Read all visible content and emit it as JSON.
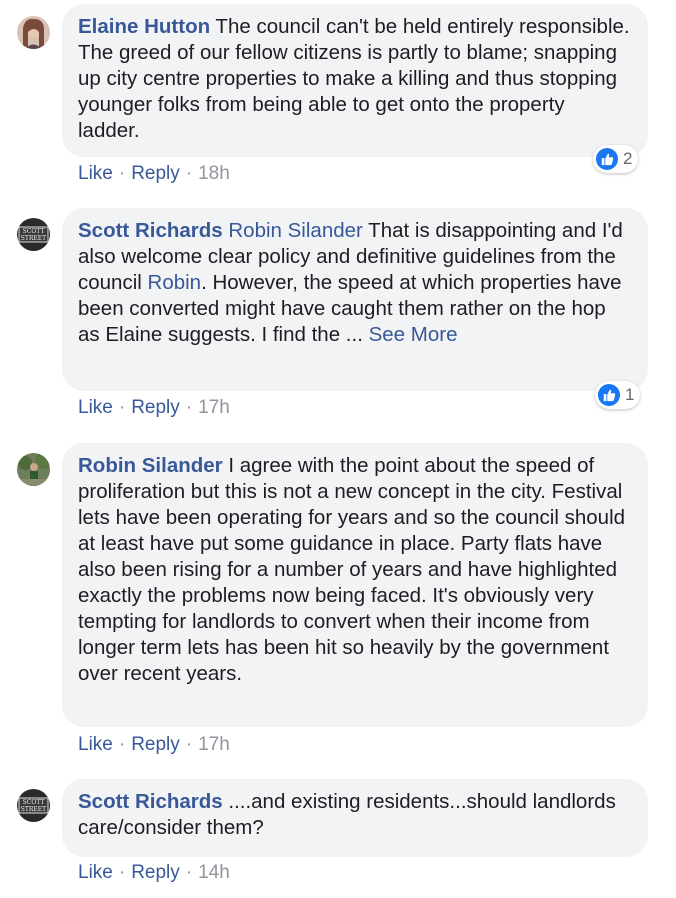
{
  "comments": [
    {
      "author": "Elaine Hutton",
      "text": " The council can't be held entirely responsible. The greed of our fellow citizens is partly to blame; snapping up city centre properties to make a killing and thus stopping younger folks from being able to get onto the property ladder.",
      "like": "Like",
      "reply": "Reply",
      "time": "18h",
      "reaction_count": "2",
      "reaction_icon": "like-icon",
      "accent": "#385898"
    },
    {
      "author": "Scott Richards",
      "mention": "Robin Silander",
      "text_a": " That is disappointing and I'd also welcome clear policy and definitive guidelines from the council ",
      "mention2": "Robin",
      "text_b": ". However, the speed at which properties have been converted might have caught them rather on the hop as Elaine suggests. I find the ... ",
      "see_more": "See More",
      "like": "Like",
      "reply": "Reply",
      "time": "17h",
      "reaction_count": "1",
      "reaction_icon": "like-icon"
    },
    {
      "author": "Robin Silander",
      "text": " I agree with the point about the speed of proliferation but this is not a new concept in the city. Festival lets have been operating for years and so the council should at least have put some guidance in place. Party flats have also been rising for a number of years and have highlighted exactly the problems now being faced. It's obviously very tempting for landlords to convert when their income from longer term lets has been hit so heavily by the government over recent years.",
      "like": "Like",
      "reply": "Reply",
      "time": "17h"
    },
    {
      "author": "Scott Richards",
      "text": " ....and existing residents...should landlords care/consider them?",
      "like": "Like",
      "reply": "Reply",
      "time": "14h"
    }
  ],
  "colors": {
    "link": "#385898",
    "bubble": "#f2f3f5",
    "meta": "#90949c",
    "like_blue": "#1877f2"
  }
}
